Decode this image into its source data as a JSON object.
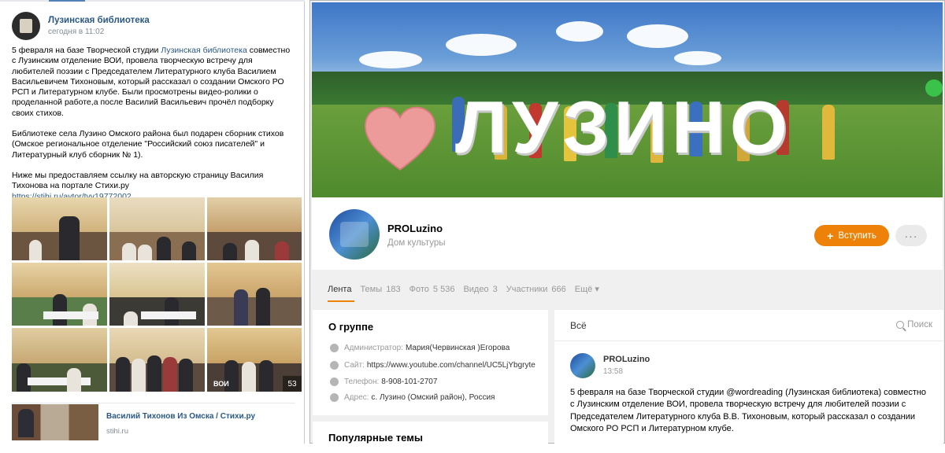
{
  "vk": {
    "group_name": "Лузинская библиотека",
    "time": "сегодня в 11:02",
    "text_part1": "5 февраля на базе Творческой студии ",
    "text_link": "Лузинская библиотека",
    "text_part2": " совместно с Лузинским отделение ВОИ, провела творческую встречу для любителей поэзии с Председателем Литературного клуба Василием Васильевичем Тихоновым, который рассказал о создании Омского РО РСП и Литературном клубе. Были просмотрены видео-ролики о проделанной работе,а после Василий Васильевич прочёл подборку своих стихов.",
    "paragraph2": "Библиотеке села Лузино Омского района был подарен сборник стихов (Омское региональное отделение \"Российский союз писателей\" и Литературный клуб сборник № 1).",
    "paragraph3": "Ниже мы предоставляем ссылку на авторскую страницу Василия Тихонова на портале Стихи.ру",
    "link_url": "https://stihi.ru/avtor/tvv19772002",
    "photo_label": "ВОИ",
    "photo_count": "53",
    "link_card": {
      "title": "Василий Тихонов Из Омска / Стихи.ру",
      "domain": "stihi.ru"
    }
  },
  "ok": {
    "cover_word": "ЛУЗИНО",
    "group_name": "PROLuzino",
    "group_type": "Дом культуры",
    "join_label": "Вступить",
    "join_icon": "+",
    "more_label": "···",
    "tabs": [
      {
        "label": "Лента",
        "count": ""
      },
      {
        "label": "Темы",
        "count": "183"
      },
      {
        "label": "Фото",
        "count": "5 536"
      },
      {
        "label": "Видео",
        "count": "3"
      },
      {
        "label": "Участники",
        "count": "666"
      },
      {
        "label": "Ещё ▾",
        "count": ""
      }
    ],
    "about": {
      "title": "О группе",
      "admin_label": "Администратор:",
      "admin_value": "Мария(Червинская )Егорова",
      "site_label": "Сайт:",
      "site_value": "https://www.youtube.com/channel/UC5LjYbgryte",
      "phone_label": "Телефон:",
      "phone_value": "8-908-101-2707",
      "address_label": "Адрес:",
      "address_value": "с. Лузино (Омский район), Россия"
    },
    "popular_title": "Популярные темы",
    "feed": {
      "all_label": "Всё",
      "search_label": "Поиск",
      "post_author": "PROLuzino",
      "post_time": "13:58",
      "post_text": "5 февраля на базе Творческой студии @wordreading (Лузинская библиотека) совместно с Лузинским отделение ВОИ, провела творческую встречу для любителей поэзии с Председателем Литературного клуба В.В. Тихоновым, который рассказал о создании Омского РО РСП и Литературном клубе."
    }
  },
  "colors": {
    "accent_orange": "#ee8208",
    "vk_link": "#2a5885",
    "muted": "#999999"
  }
}
